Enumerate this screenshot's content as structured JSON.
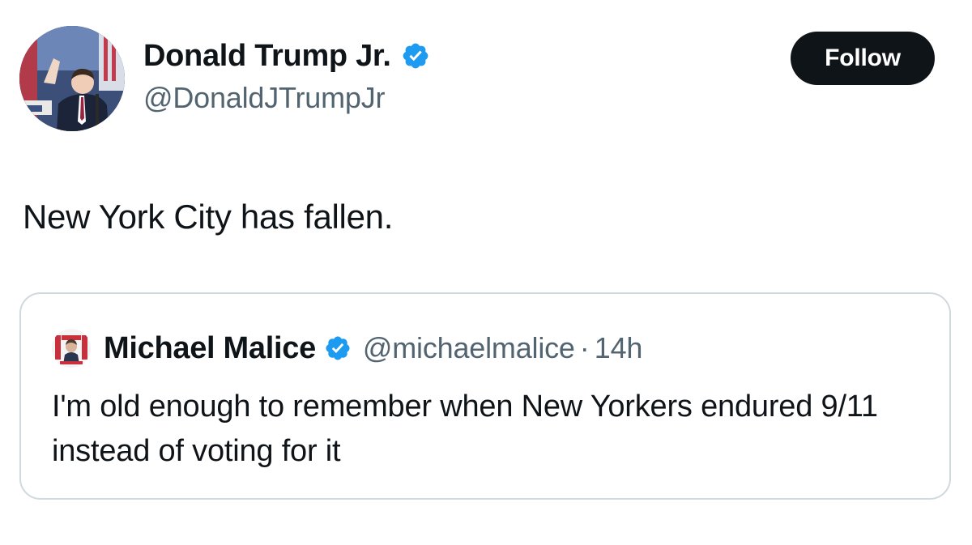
{
  "tweet": {
    "author_name": "Donald Trump Jr.",
    "author_handle": "@DonaldJTrumpJr",
    "verified_icon": "verified-badge-icon",
    "follow_label": "Follow",
    "text": "New York City has fallen."
  },
  "quoted_tweet": {
    "author_name": "Michael Malice",
    "author_handle": "@michaelmalice",
    "separator": "·",
    "time": "14h",
    "text": "I'm old enough to remember when New Yorkers endured 9/11 instead of voting for it"
  },
  "colors": {
    "verified_blue": "#1d9bf0",
    "text_primary": "#0f1419",
    "text_secondary": "#536471",
    "border": "#cfd9de",
    "follow_bg": "#0f1419"
  }
}
